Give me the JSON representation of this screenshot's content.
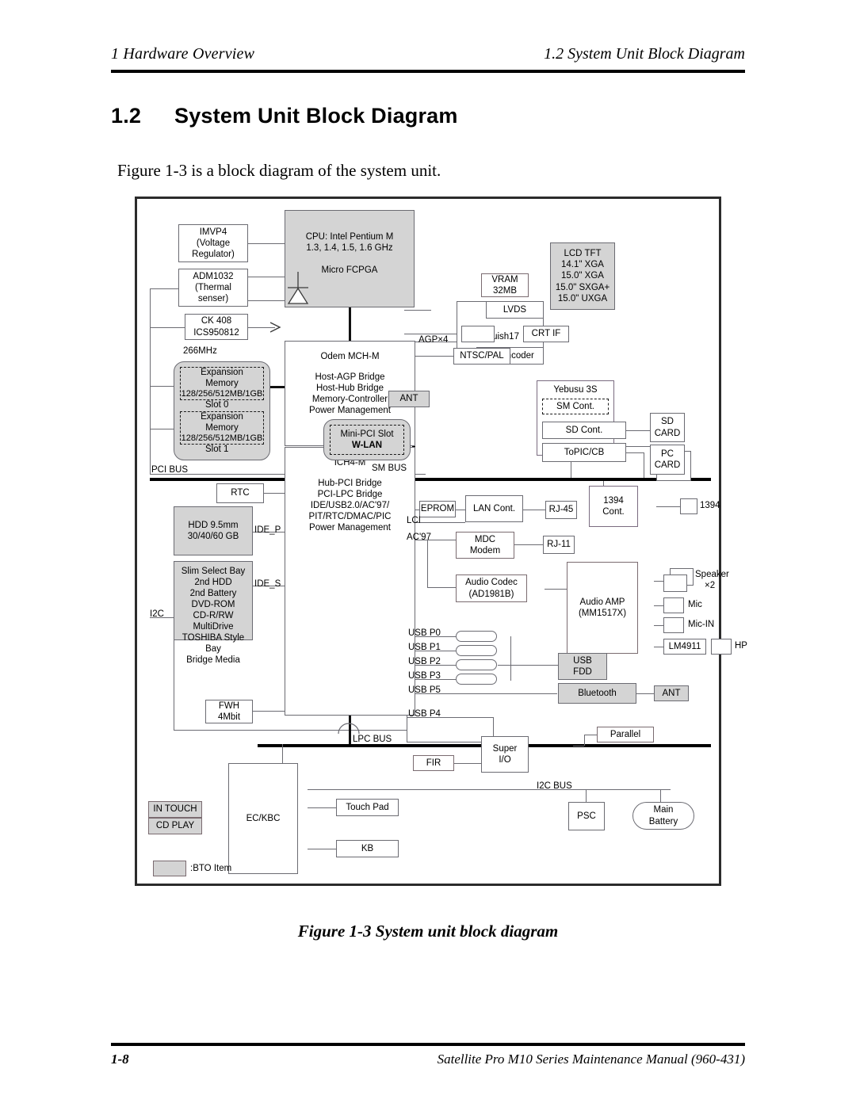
{
  "header": {
    "left": "1  Hardware Overview",
    "right": "1.2  System Unit Block Diagram"
  },
  "section": {
    "number": "1.2",
    "title": "System Unit Block Diagram",
    "intro": "Figure 1-3 is a block diagram of the system unit."
  },
  "figure": {
    "caption": "Figure 1-3  System unit block diagram",
    "legend_label": ":BTO Item"
  },
  "footer": {
    "page": "1-8",
    "manual": "Satellite Pro M10 Series Maintenance Manual (960-431)"
  },
  "blocks": {
    "imvp4": "IMVP4\n(Voltage\nRegulator)",
    "imvp4_l1": "IMVP4",
    "imvp4_l2": "(Voltage",
    "imvp4_l3": "Regulator)",
    "adm1032_l1": "ADM1032",
    "adm1032_l2": "(Thermal",
    "adm1032_l3": "senser)",
    "ck408_l1": "CK 408",
    "ck408_l2": "ICS950812",
    "cpu_l1": "CPU: Intel Pentium M",
    "cpu_l2": "1.3, 1.4, 1.5, 1.6 GHz",
    "cpu_l3": "Micro FCPGA",
    "mch_l1": "Odem MCH-M",
    "mch_l2": "Host-AGP Bridge",
    "mch_l3": "Host-Hub Bridge",
    "mch_l4": "Memory-Controller",
    "mch_l5": "Power Management",
    "ich_l1": "ICH4-M",
    "ich_l2": "Hub-PCI Bridge",
    "ich_l3": "PCI-LPC Bridge",
    "ich_l4": "IDE/USB2.0/AC'97/",
    "ich_l5": "PIT/RTC/DMAC/PIC",
    "ich_l6": "Power Management",
    "mem_freq": "266MHz",
    "mem0_l1": "Expansion",
    "mem0_l2": "Memory",
    "mem0_l3": "128/256/512MB/1GB",
    "mem0_slot": "Slot 0",
    "mem1_l1": "Expansion",
    "mem1_l2": "Memory",
    "mem1_l3": "128/256/512MB/1GB",
    "mem1_slot": "Slot 1",
    "rtc": "RTC",
    "hdd_l1": "HDD 9.5mm",
    "hdd_l2": "30/40/60 GB",
    "bay_l1": "Slim Select Bay",
    "bay_l2": "2nd HDD",
    "bay_l3": "2nd Battery",
    "bay_l4": "DVD-ROM",
    "bay_l5": "CD-R/RW",
    "bay_l6": "MultiDrive",
    "bay_l7": "TOSHIBA Style Bay",
    "bay_l8": "Bridge Media",
    "fwh_l1": "FWH",
    "fwh_l2": "4Mbit",
    "vram_l1": "VRAM",
    "vram_l2": "32MB",
    "squish": "Squish17",
    "lvds": "LVDS",
    "tv_encoder": "TV Encoder",
    "ntsc_pal": "NTSC/PAL",
    "crt_if": "CRT IF",
    "lcd_l1": "LCD TFT",
    "lcd_l2": "14.1\" XGA",
    "lcd_l3": "15.0\" XGA",
    "lcd_l4": "15.0\" SXGA+",
    "lcd_l5": "15.0\" UXGA",
    "ant_wlan": "ANT",
    "minipci_l1": "Mini-PCI Slot",
    "minipci_l2": "W-LAN",
    "yebusu": "Yebusu 3S",
    "sm_cont": "SM Cont.",
    "sd_cont": "SD Cont.",
    "topic_cb": "ToPIC/CB",
    "sd_card_l1": "SD",
    "sd_card_l2": "CARD",
    "pc_card_l1": "PC",
    "pc_card_l2": "CARD",
    "eprom": "EPROM",
    "lan_cont": "LAN Cont.",
    "rj45": "RJ-45",
    "c1394_l1": "1394",
    "c1394_l2": "Cont.",
    "c1394_port": "1394",
    "mdc_l1": "MDC",
    "mdc_l2": "Modem",
    "rj11": "RJ-11",
    "codec_l1": "Audio Codec",
    "codec_l2": "(AD1981B)",
    "amp_l1": "Audio AMP",
    "amp_l2": "(MM1517X)",
    "speaker_l1": "Speaker",
    "speaker_l2": "×2",
    "mic": "Mic",
    "mic_in": "Mic-IN",
    "lm4911": "LM4911",
    "hp": "HP",
    "usb_fdd_l1": "USB",
    "usb_fdd_l2": "FDD",
    "bluetooth": "Bluetooth",
    "ant_bt": "ANT",
    "super_io_l1": "Super",
    "super_io_l2": "I/O",
    "fir": "FIR",
    "parallel": "Parallel",
    "ec_kbc": "EC/KBC",
    "in_touch": "IN TOUCH",
    "cd_play": "CD PLAY",
    "touch_pad": "Touch Pad",
    "kb": "KB",
    "psc": "PSC",
    "battery_l1": "Main",
    "battery_l2": "Battery"
  },
  "bus_labels": {
    "agp": "AGP×4",
    "sm_bus": "SM BUS",
    "pci_bus": "PCI BUS",
    "lpc_bus": "LPC BUS",
    "i2c_bus": "I2C BUS",
    "i2c": "I2C",
    "ide_p": "IDE_P",
    "ide_s": "IDE_S",
    "lci": "LCI",
    "ac97": "AC'97",
    "usb_p0": "USB P0",
    "usb_p1": "USB P1",
    "usb_p2": "USB P2",
    "usb_p3": "USB P3",
    "usb_p5": "USB P5",
    "usb_p4": "USB P4"
  },
  "colors": {
    "line": "#6b6b72",
    "bus": "#000000",
    "bto_fill": "#d4d4d4",
    "frame": "#2b2b2b"
  }
}
